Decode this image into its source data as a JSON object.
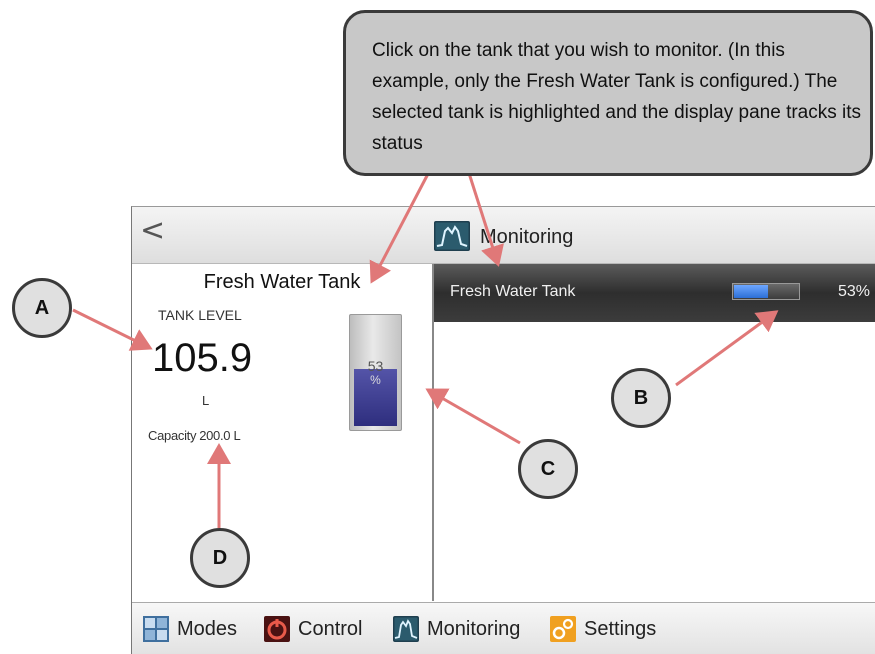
{
  "header": {
    "back_label": "<",
    "title": "Monitoring"
  },
  "tank_detail": {
    "name": "Fresh Water Tank",
    "level_label": "TANK LEVEL",
    "level_value": "105.9",
    "level_unit": "L",
    "capacity_label": "Capacity",
    "capacity_value": "200.0 L",
    "gauge_percent_value": "53",
    "gauge_percent_sign": "%",
    "gauge_fill_fraction": 0.53,
    "gauge_fill_color": "#3a3a8e"
  },
  "tank_list": [
    {
      "name": "Fresh Water Tank",
      "percent_label": "53%",
      "fill_fraction": 0.53,
      "selected": true
    }
  ],
  "footer_nav": [
    {
      "label": "Modes",
      "icon": "modes-icon"
    },
    {
      "label": "Control",
      "icon": "control-icon"
    },
    {
      "label": "Monitoring",
      "icon": "monitoring-icon"
    },
    {
      "label": "Settings",
      "icon": "settings-icon"
    }
  ],
  "annotations": {
    "callout_text": "Click on the tank that you wish to monitor. (In this example, only the Fresh Water Tank is configured.) The selected tank is highlighted and the display pane tracks its status",
    "markers": [
      "A",
      "B",
      "C",
      "D"
    ],
    "arrow_color": "#e07878"
  }
}
